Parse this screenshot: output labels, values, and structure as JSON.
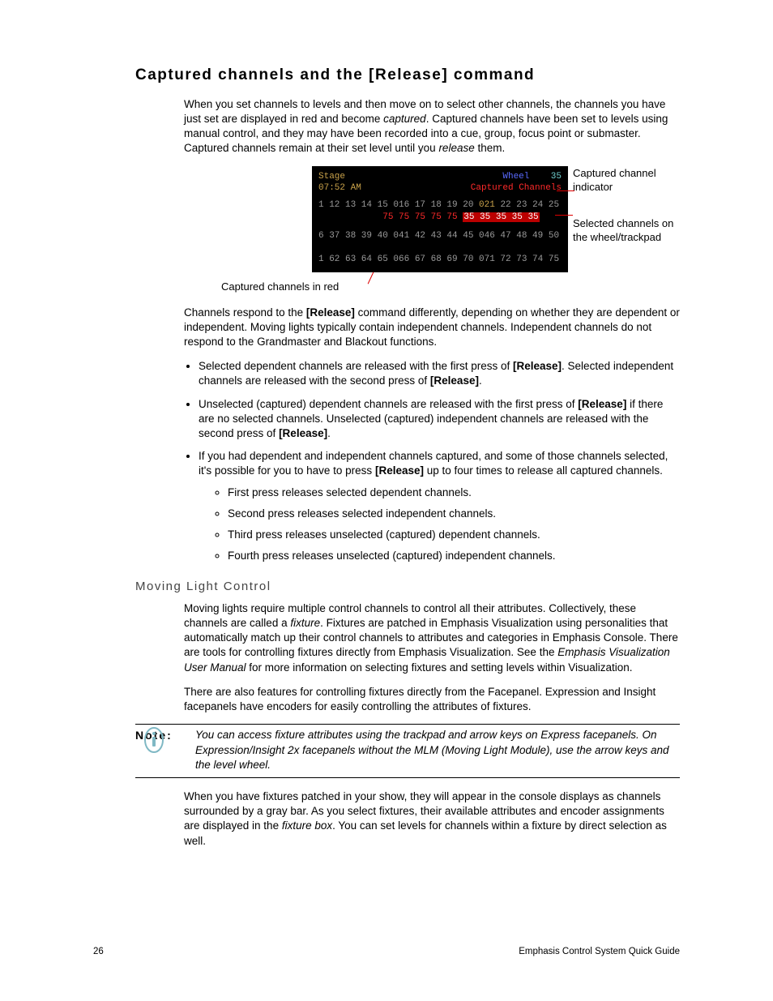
{
  "h1": "Captured channels and the [Release] command",
  "p1a": "When you set channels to levels and then move on to select other channels, the channels you have just set are displayed in red and become ",
  "p1b": "captured",
  "p1c": ". Captured channels have been set to levels using manual control, and they may have been recorded into a cue, group, focus point or submaster. Captured channels remain at their set level until you ",
  "p1d": "release",
  "p1e": " them.",
  "fig": {
    "stage": "Stage",
    "time": "07:52 AM",
    "wheel": "Wheel",
    "wheelval": "35",
    "capchan": "Captured Channels",
    "row1": "1 12 13 14 15 016 17 18 19 20 ",
    "row1gold": "021",
    "row1grey": " 22 23 24 25",
    "row1r": "            75 75 75 75 75 ",
    "row1hl": "35 35 35 35 35",
    "row2": "6 37 38 39 40 041 42 43 44 45 046 47 48 49 50",
    "row3": "1 62 63 64 65 066 67 68 69 70 071 72 73 74 75",
    "cap_red": "Captured channels in red",
    "cap_ind": "Captured channel indicator",
    "cap_sel": "Selected channels on the wheel/trackpad"
  },
  "p2a": "Channels respond to the ",
  "p2b": "[Release]",
  "p2c": " command differently, depending on whether they are dependent or independent. Moving lights typically contain independent channels. Independent channels do not respond to the Grandmaster and Blackout functions.",
  "li1a": "Selected dependent channels are released with the first press of ",
  "li1b": "[Release]",
  "li1c": ". Selected independent channels are released with the second press of ",
  "li1d": "[Release]",
  "li1e": ".",
  "li2a": "Unselected (captured) dependent channels are released with the first press of ",
  "li2b": "[Release]",
  "li2c": " if there are no selected channels. Unselected (captured) independent channels are released with the second press of ",
  "li2d": "[Release]",
  "li2e": ".",
  "li3a": "If you had dependent and independent channels captured, and some of those channels selected, it's possible for you to have to press ",
  "li3b": "[Release]",
  "li3c": " up to four times to release all captured channels.",
  "sub": {
    "a": "First press releases selected dependent channels.",
    "b": "Second press releases selected independent channels.",
    "c": "Third press releases unselected (captured) dependent channels.",
    "d": "Fourth press releases unselected (captured) independent channels."
  },
  "h2": "Moving Light Control",
  "p3a": "Moving lights require multiple control channels to control all their attributes. Collectively, these channels are called a ",
  "p3b": "fixture",
  "p3c": ". Fixtures are patched in Emphasis Visualization using personalities that automatically match up their control channels to attributes and categories in Emphasis Console. There are tools for controlling fixtures directly from Emphasis Visualization. See the ",
  "p3d": "Emphasis Visualization User Manual",
  "p3e": " for more information on selecting fixtures and setting levels within Visualization.",
  "p4": "There are also features for controlling fixtures directly from the Facepanel. Expression and Insight facepanels have encoders for easily controlling the attributes of fixtures.",
  "note_label": "Note:",
  "note_text": "You can access fixture attributes using the trackpad and arrow keys on Express facepanels. On Expression/Insight 2x facepanels without the MLM (Moving Light Module), use the arrow keys and the level wheel.",
  "p5a": "When you have fixtures patched in your show, they will appear in the console displays as channels surrounded by a gray bar. As you select fixtures, their available attributes and encoder assignments are displayed in the ",
  "p5b": "fixture box",
  "p5c": ". You can set levels for channels within a fixture by direct selection as well.",
  "footer_left": "26",
  "footer_right": "Emphasis Control System Quick Guide"
}
